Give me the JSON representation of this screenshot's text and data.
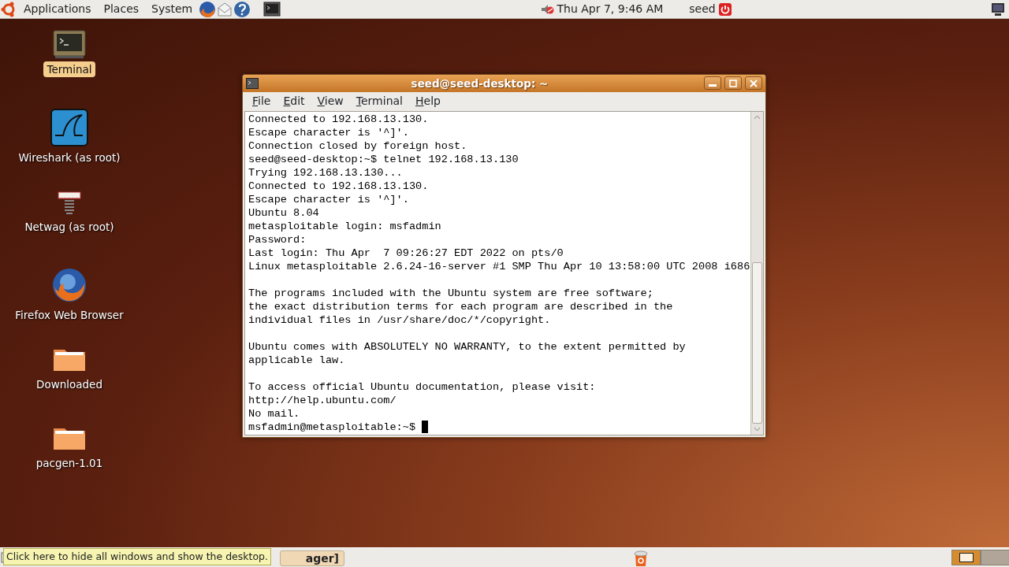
{
  "top_panel": {
    "menus": [
      "Applications",
      "Places",
      "System"
    ],
    "clock": "Thu Apr  7,  9:46 AM",
    "user": "seed"
  },
  "desktop_icons": [
    {
      "kind": "terminal",
      "label": "Terminal",
      "selected": true
    },
    {
      "kind": "wireshark",
      "label": "Wireshark (as root)",
      "selected": false
    },
    {
      "kind": "netwag",
      "label": "Netwag (as root)",
      "selected": false
    },
    {
      "kind": "firefox",
      "label": "Firefox Web Browser",
      "selected": false
    },
    {
      "kind": "folder",
      "label": "Downloaded",
      "selected": false
    },
    {
      "kind": "folder",
      "label": "pacgen-1.01",
      "selected": false
    }
  ],
  "window": {
    "title": "seed@seed-desktop: ~",
    "menu": [
      "File",
      "Edit",
      "View",
      "Terminal",
      "Help"
    ],
    "blocks": [
      [
        "Connected to 192.168.13.130.",
        "Escape character is '^]'.",
        "Connection closed by foreign host.",
        "seed@seed-desktop:~$ telnet 192.168.13.130",
        "Trying 192.168.13.130...",
        "Connected to 192.168.13.130.",
        "Escape character is '^]'.",
        "Ubuntu 8.04",
        "metasploitable login: msfadmin",
        "Password:",
        "Last login: Thu Apr  7 09:26:27 EDT 2022 on pts/0",
        "Linux metasploitable 2.6.24-16-server #1 SMP Thu Apr 10 13:58:00 UTC 2008 i686"
      ],
      [
        "The programs included with the Ubuntu system are free software;",
        "the exact distribution terms for each program are described in the",
        "individual files in /usr/share/doc/*/copyright."
      ],
      [
        "Ubuntu comes with ABSOLUTELY NO WARRANTY, to the extent permitted by",
        "applicable law."
      ],
      [
        "To access official Ubuntu documentation, please visit:",
        "http://help.ubuntu.com/",
        "No mail."
      ]
    ],
    "prompt": "msfadmin@metasploitable:~$ "
  },
  "bottom_panel": {
    "task": "ager]",
    "tooltip": "Click here to hide all windows and show the desktop.",
    "workspaces": [
      {
        "selected": true
      },
      {
        "selected": false
      }
    ]
  }
}
